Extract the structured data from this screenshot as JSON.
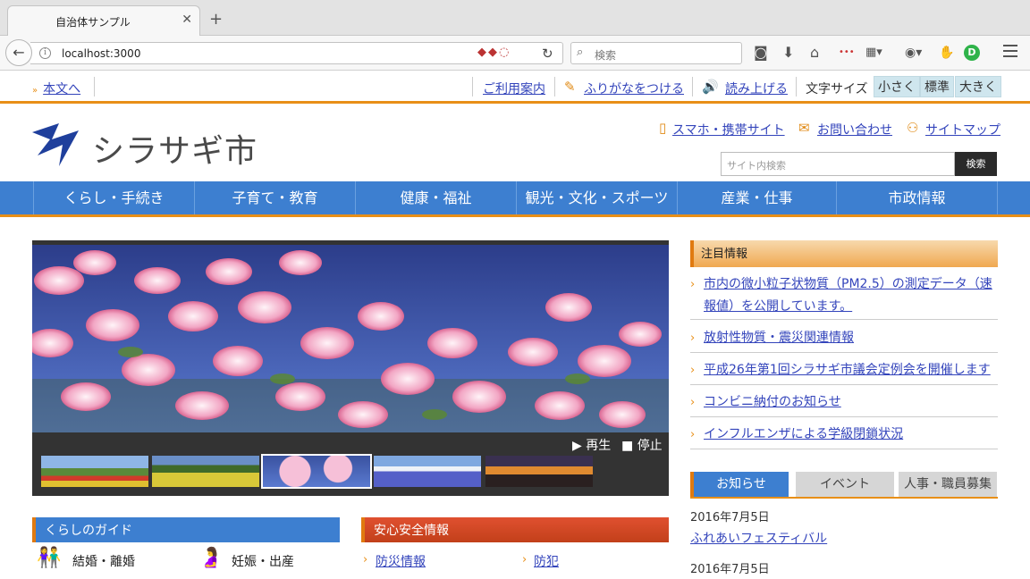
{
  "browser": {
    "tab_title": "自治体サンプル",
    "url": "localhost:3000",
    "search_placeholder": "検索"
  },
  "utility": {
    "skip_link": "本文へ",
    "guide": "ご利用案内",
    "furigana": "ふりがなをつける",
    "read_aloud": "読み上げる",
    "text_size_label": "文字サイズ",
    "size_small": "小さく",
    "size_normal": "標準",
    "size_large": "大きく"
  },
  "header": {
    "site_name": "シラサギ市",
    "mobile_link": "スマホ・携帯サイト",
    "contact_link": "お問い合わせ",
    "sitemap_link": "サイトマップ",
    "search_placeholder": "サイト内検索",
    "search_button": "検索"
  },
  "gnav": [
    "くらし・手続き",
    "子育て・教育",
    "健康・福祉",
    "観光・文化・スポーツ",
    "産業・仕事",
    "市政情報"
  ],
  "slider": {
    "play": "再生",
    "stop": "停止",
    "active_thumb": 2
  },
  "notices": {
    "title": "注目情報",
    "items": [
      "市内の微小粒子状物質（PM2.5）の測定データ（速報値）を公開しています。",
      "放射性物質・震災関連情報",
      "平成26年第1回シラサギ市議会定例会を開催します",
      "コンビニ納付のお知らせ",
      "インフルエンザによる学級閉鎖状況"
    ]
  },
  "news": {
    "tabs": [
      "お知らせ",
      "イベント",
      "人事・職員募集"
    ],
    "entries": [
      {
        "date": "2016年7月5日",
        "title": "ふれあいフェスティバル"
      },
      {
        "date": "2016年7月5日",
        "title": ""
      }
    ]
  },
  "guide_panel": {
    "title": "くらしのガイド",
    "items": [
      "結婚・離婚",
      "妊娠・出産"
    ]
  },
  "safety_panel": {
    "title": "安心安全情報",
    "items": [
      "防災情報",
      "防犯"
    ]
  },
  "colors": {
    "accent_orange": "#e88f18",
    "nav_blue": "#3d7fd0",
    "link_blue": "#3344bb",
    "safety_red": "#c2401a"
  }
}
